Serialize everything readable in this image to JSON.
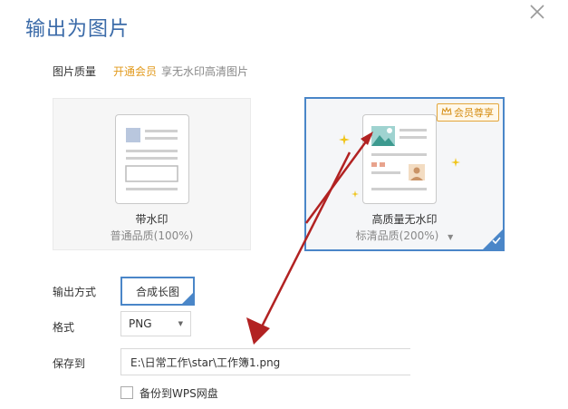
{
  "dialog": {
    "title": "输出为图片"
  },
  "quality": {
    "label": "图片质量",
    "vip_link": "开通会员",
    "vip_desc": "享无水印高清图片",
    "options": [
      {
        "title": "带水印",
        "sub": "普通品质(100%)",
        "selected": false
      },
      {
        "title": "高质量无水印",
        "sub": "标清品质(200%)",
        "selected": true,
        "badge": "会员尊享"
      }
    ]
  },
  "output_mode": {
    "label": "输出方式",
    "value": "合成长图"
  },
  "format": {
    "label": "格式",
    "value": "PNG"
  },
  "save_to": {
    "label": "保存到",
    "value": "E:\\日常工作\\star\\工作簿1.png"
  },
  "backup": {
    "label": "备份到WPS网盘",
    "checked": false
  },
  "colors": {
    "accent": "#4a86c8",
    "vip": "#e29a1d",
    "annotation_arrow": "#b22222"
  }
}
